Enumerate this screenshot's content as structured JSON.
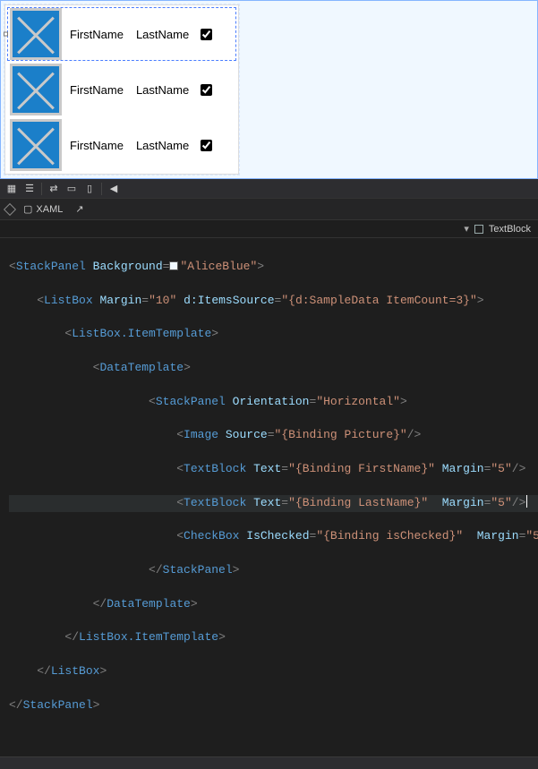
{
  "design": {
    "rows": [
      {
        "first": "FirstName",
        "last": "LastName",
        "checked": true
      },
      {
        "first": "FirstName",
        "last": "LastName",
        "checked": true
      },
      {
        "first": "FirstName",
        "last": "LastName",
        "checked": true
      }
    ]
  },
  "tabs": {
    "xaml": "XAML"
  },
  "breadcrumb": {
    "current": "TextBlock"
  },
  "code": {
    "ind": {
      "i1": "    ",
      "i2": "        ",
      "i3": "            ",
      "i4": "                ",
      "i5": "                    ",
      "i6": "                        "
    },
    "l1": {
      "open": "<",
      "tag": "StackPanel",
      "sp": " ",
      "a1n": "Background",
      "eq": "=",
      "a1v": "\"AliceBlue\"",
      "close": ">"
    },
    "l2": {
      "open": "<",
      "tag": "ListBox",
      "sp": " ",
      "a1n": "Margin",
      "eq": "=",
      "a1v": "\"10\"",
      "sp2": " ",
      "a2n": "d:ItemsSource",
      "a2v": "\"{d:SampleData ItemCount=3}\"",
      "close": ">"
    },
    "l3": {
      "open": "<",
      "tag": "ListBox.ItemTemplate",
      "close": ">"
    },
    "l4": {
      "open": "<",
      "tag": "DataTemplate",
      "close": ">"
    },
    "l5": {
      "open": "<",
      "tag": "StackPanel",
      "sp": " ",
      "a1n": "Orientation",
      "eq": "=",
      "a1v": "\"Horizontal\"",
      "close": ">"
    },
    "l6": {
      "open": "<",
      "tag": "Image",
      "sp": " ",
      "a1n": "Source",
      "eq": "=",
      "a1v": "\"{Binding Picture}\"",
      "close": "/>"
    },
    "l7": {
      "open": "<",
      "tag": "TextBlock",
      "sp": " ",
      "a1n": "Text",
      "eq": "=",
      "a1v": "\"{Binding FirstName}\"",
      "sp2": " ",
      "a2n": "Margin",
      "a2v": "\"5\"",
      "close": "/>"
    },
    "l8": {
      "open": "<",
      "tag": "TextBlock",
      "sp": " ",
      "a1n": "Text",
      "eq": "=",
      "a1v": "\"{Binding LastName}\"",
      "sp2": "  ",
      "a2n": "Margin",
      "a2v": "\"5\"",
      "close": "/>",
      "caret_after_close": true
    },
    "l9": {
      "open": "<",
      "tag": "CheckBox",
      "sp": " ",
      "a1n": "IsChecked",
      "eq": "=",
      "a1v": "\"{Binding isChecked}\"",
      "sp2": "  ",
      "a2n": "Margin",
      "a2v": "\"5\"",
      "close": "/>"
    },
    "l10": {
      "open": "</",
      "tag": "StackPanel",
      "close": ">"
    },
    "l11": {
      "open": "</",
      "tag": "DataTemplate",
      "close": ">"
    },
    "l12": {
      "open": "</",
      "tag": "ListBox.ItemTemplate",
      "close": ">"
    },
    "l13": {
      "open": "</",
      "tag": "ListBox",
      "close": ">"
    },
    "l14": {
      "open": "</",
      "tag": "StackPanel",
      "close": ">"
    }
  }
}
